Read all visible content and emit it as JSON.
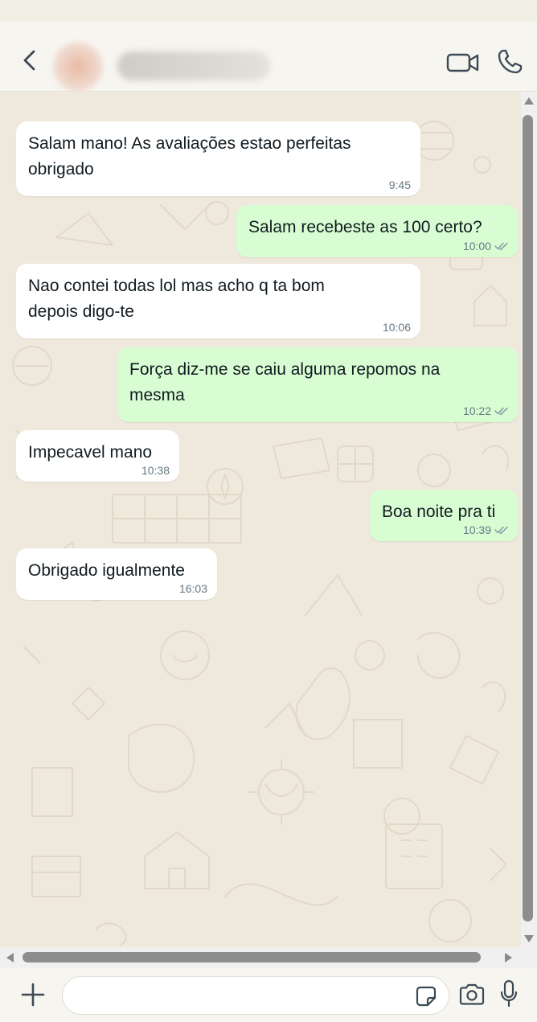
{
  "header": {
    "contact_name": "",
    "icons": {
      "back": "chevron-left-icon",
      "video": "video-camera-icon",
      "call": "phone-icon"
    }
  },
  "messages": [
    {
      "direction": "in",
      "text_lines": [
        "Salam mano! As avaliações estao perfeitas",
        "obrigado"
      ],
      "time": "9:45"
    },
    {
      "direction": "out",
      "text_lines": [
        "Salam recebeste as 100 certo?"
      ],
      "time": "10:00",
      "status": "read"
    },
    {
      "direction": "in",
      "text_lines": [
        "Nao contei todas lol mas acho q ta bom",
        "depois digo-te"
      ],
      "time": "10:06"
    },
    {
      "direction": "out",
      "text_lines": [
        "Força diz-me se caiu alguma repomos na",
        "mesma"
      ],
      "time": "10:22",
      "status": "read"
    },
    {
      "direction": "in",
      "text_lines": [
        "Impecavel mano"
      ],
      "time": "10:38"
    },
    {
      "direction": "out",
      "text_lines": [
        "Boa noite pra ti"
      ],
      "time": "10:39",
      "status": "read"
    },
    {
      "direction": "in",
      "text_lines": [
        "Obrigado igualmente"
      ],
      "time": "16:03"
    }
  ],
  "composer": {
    "value": "",
    "placeholder": "",
    "icons": {
      "attach": "plus-icon",
      "sticker": "sticker-icon",
      "camera": "camera-icon",
      "mic": "microphone-icon"
    }
  },
  "colors": {
    "incoming_bubble": "#ffffff",
    "outgoing_bubble": "#d9fdd3",
    "chat_background": "#efe9dd",
    "meta_text": "#667781"
  }
}
